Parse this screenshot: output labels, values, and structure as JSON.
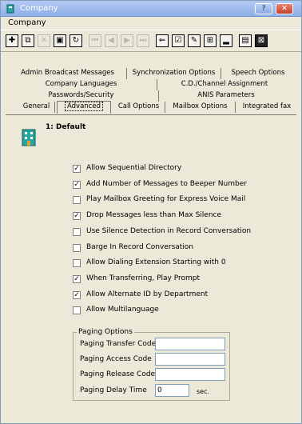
{
  "window": {
    "title": "Company",
    "help_symbol": "?",
    "close_symbol": "✕"
  },
  "menu": {
    "label": "Company"
  },
  "toolbar": {
    "buttons": [
      {
        "name": "add-icon",
        "glyph": "✚"
      },
      {
        "name": "copy-icon",
        "glyph": "⧉"
      },
      {
        "name": "delete-icon",
        "glyph": "✕"
      },
      {
        "name": "save-icon",
        "glyph": "▣"
      },
      {
        "name": "refresh-icon",
        "glyph": "↻"
      },
      {
        "name": "first-record-icon",
        "glyph": "⏮"
      },
      {
        "name": "previous-record-icon",
        "glyph": "◀"
      },
      {
        "name": "next-record-icon",
        "glyph": "▶"
      },
      {
        "name": "last-record-icon",
        "glyph": "⏭"
      },
      {
        "name": "find-icon",
        "glyph": "⇐"
      },
      {
        "name": "checklist-icon",
        "glyph": "☑"
      },
      {
        "name": "edit-icon",
        "glyph": "✎"
      },
      {
        "name": "properties-icon",
        "glyph": "⊞"
      },
      {
        "name": "chart-icon",
        "glyph": "▂"
      },
      {
        "name": "report-icon",
        "glyph": "▤"
      },
      {
        "name": "exit-icon",
        "glyph": "⊠"
      }
    ]
  },
  "tabs": {
    "row1": [
      "Admin Broadcast Messages",
      "Synchronization Options",
      "Speech Options"
    ],
    "row2": [
      "Company Languages",
      "C.D./Channel Assignment"
    ],
    "row3": [
      "Passwords/Security",
      "ANIS Parameters"
    ],
    "row4": [
      "General",
      "Advanced",
      "Call Options",
      "Mailbox Options",
      "Integrated fax"
    ]
  },
  "panel": {
    "title": "1: Default",
    "options": [
      {
        "label": "Allow Sequential Directory",
        "checked": true
      },
      {
        "label": "Add Number of Messages to  Beeper Number",
        "checked": true
      },
      {
        "label": "Play Mailbox Greeting for Express Voice Mail",
        "checked": false
      },
      {
        "label": "Drop Messages less than Max Silence",
        "checked": true
      },
      {
        "label": "Use Silence Detection in Record Conversation",
        "checked": false
      },
      {
        "label": "Barge In Record Conversation",
        "checked": false
      },
      {
        "label": "Allow Dialing Extension Starting with 0",
        "checked": false
      },
      {
        "label": "When Transferring, Play Prompt",
        "checked": true
      },
      {
        "label": "Allow Alternate ID by Department",
        "checked": true
      },
      {
        "label": "Allow Multilanguage",
        "checked": false
      }
    ],
    "check_mark": "✓",
    "paging": {
      "legend": "Paging Options",
      "transfer_code_label": "Paging Transfer Code",
      "transfer_code_value": "",
      "access_code_label": "Paging Access Code",
      "access_code_value": "",
      "release_code_label": "Paging Release Code",
      "release_code_value": "",
      "delay_time_label": "Paging Delay Time",
      "delay_time_value": "0",
      "delay_unit": "sec."
    }
  }
}
